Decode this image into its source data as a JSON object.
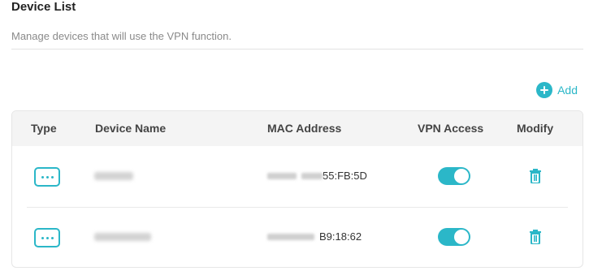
{
  "header": {
    "title": "Device List",
    "description": "Manage devices that will use the VPN function."
  },
  "toolbar": {
    "add_label": "Add",
    "add_icon": "plus-circle-icon"
  },
  "table": {
    "columns": [
      "Type",
      "Device Name",
      "MAC Address",
      "VPN Access",
      "Modify"
    ],
    "rows": [
      {
        "type_icon": "device-other-icon",
        "mac_visible": "55:FB:5D",
        "vpn_access": true,
        "modify_icon": "trash-icon"
      },
      {
        "type_icon": "device-other-icon",
        "mac_visible": "B9:18:62",
        "vpn_access": true,
        "modify_icon": "trash-icon"
      }
    ]
  },
  "colors": {
    "accent": "#2bb7c8",
    "header_bg": "#f4f4f4"
  }
}
